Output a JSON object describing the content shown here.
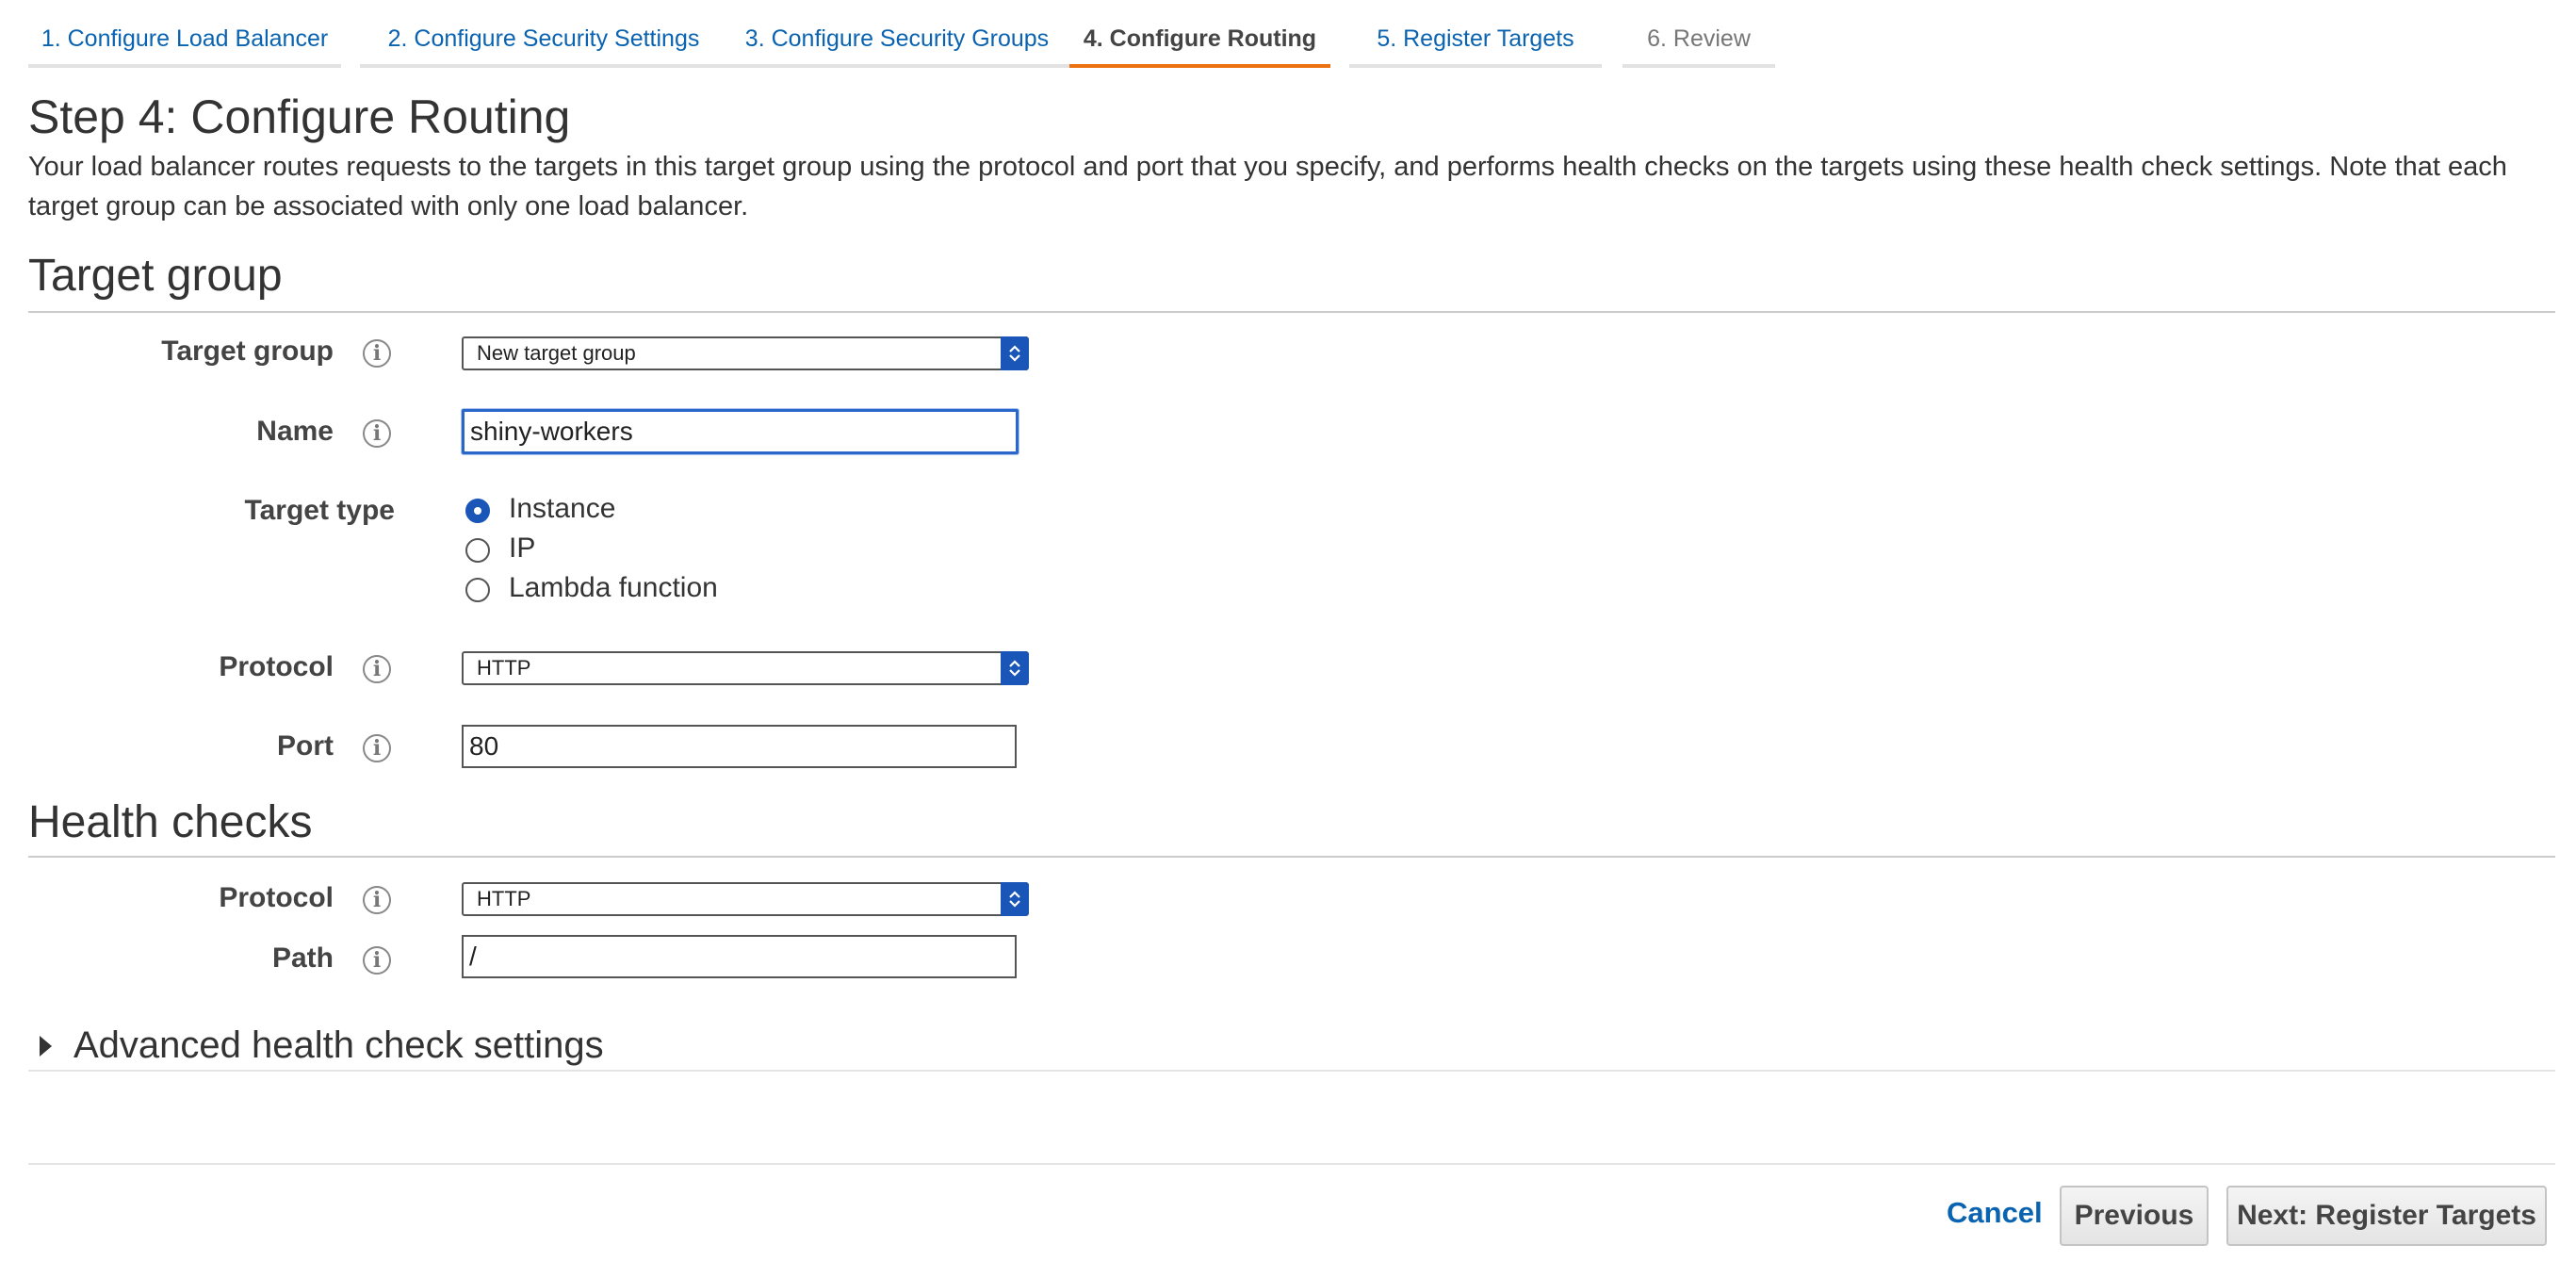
{
  "wizard": {
    "tabs": [
      {
        "label": "1. Configure Load Balancer",
        "state": "link"
      },
      {
        "label": "2. Configure Security Settings",
        "state": "link"
      },
      {
        "label": "3. Configure Security Groups",
        "state": "link"
      },
      {
        "label": "4. Configure Routing",
        "state": "active"
      },
      {
        "label": "5. Register Targets",
        "state": "link"
      },
      {
        "label": "6. Review",
        "state": "disabled"
      }
    ]
  },
  "page": {
    "title": "Step 4: Configure Routing",
    "description": "Your load balancer routes requests to the targets in this target group using the protocol and port that you specify, and performs health checks on the targets using these health check settings. Note that each target group can be associated with only one load balancer."
  },
  "target_group": {
    "heading": "Target group",
    "target_group_label": "Target group",
    "target_group_value": "New target group",
    "name_label": "Name",
    "name_value": "shiny-workers",
    "target_type_label": "Target type",
    "target_type_options": [
      {
        "label": "Instance",
        "checked": true
      },
      {
        "label": "IP",
        "checked": false
      },
      {
        "label": "Lambda function",
        "checked": false
      }
    ],
    "protocol_label": "Protocol",
    "protocol_value": "HTTP",
    "port_label": "Port",
    "port_value": "80"
  },
  "health_checks": {
    "heading": "Health checks",
    "protocol_label": "Protocol",
    "protocol_value": "HTTP",
    "path_label": "Path",
    "path_value": "/",
    "advanced_label": "Advanced health check settings"
  },
  "footer": {
    "cancel_label": "Cancel",
    "previous_label": "Previous",
    "next_label": "Next: Register Targets"
  },
  "icons": {
    "info": "info-icon",
    "select_arrow": "up-down-chevron-icon",
    "expand": "caret-right-icon"
  },
  "colors": {
    "link": "#0a63b0",
    "active_tab_underline": "#ec7211",
    "select_arrow_bg": "#1a56b8",
    "focus_border": "#2a67c9"
  }
}
